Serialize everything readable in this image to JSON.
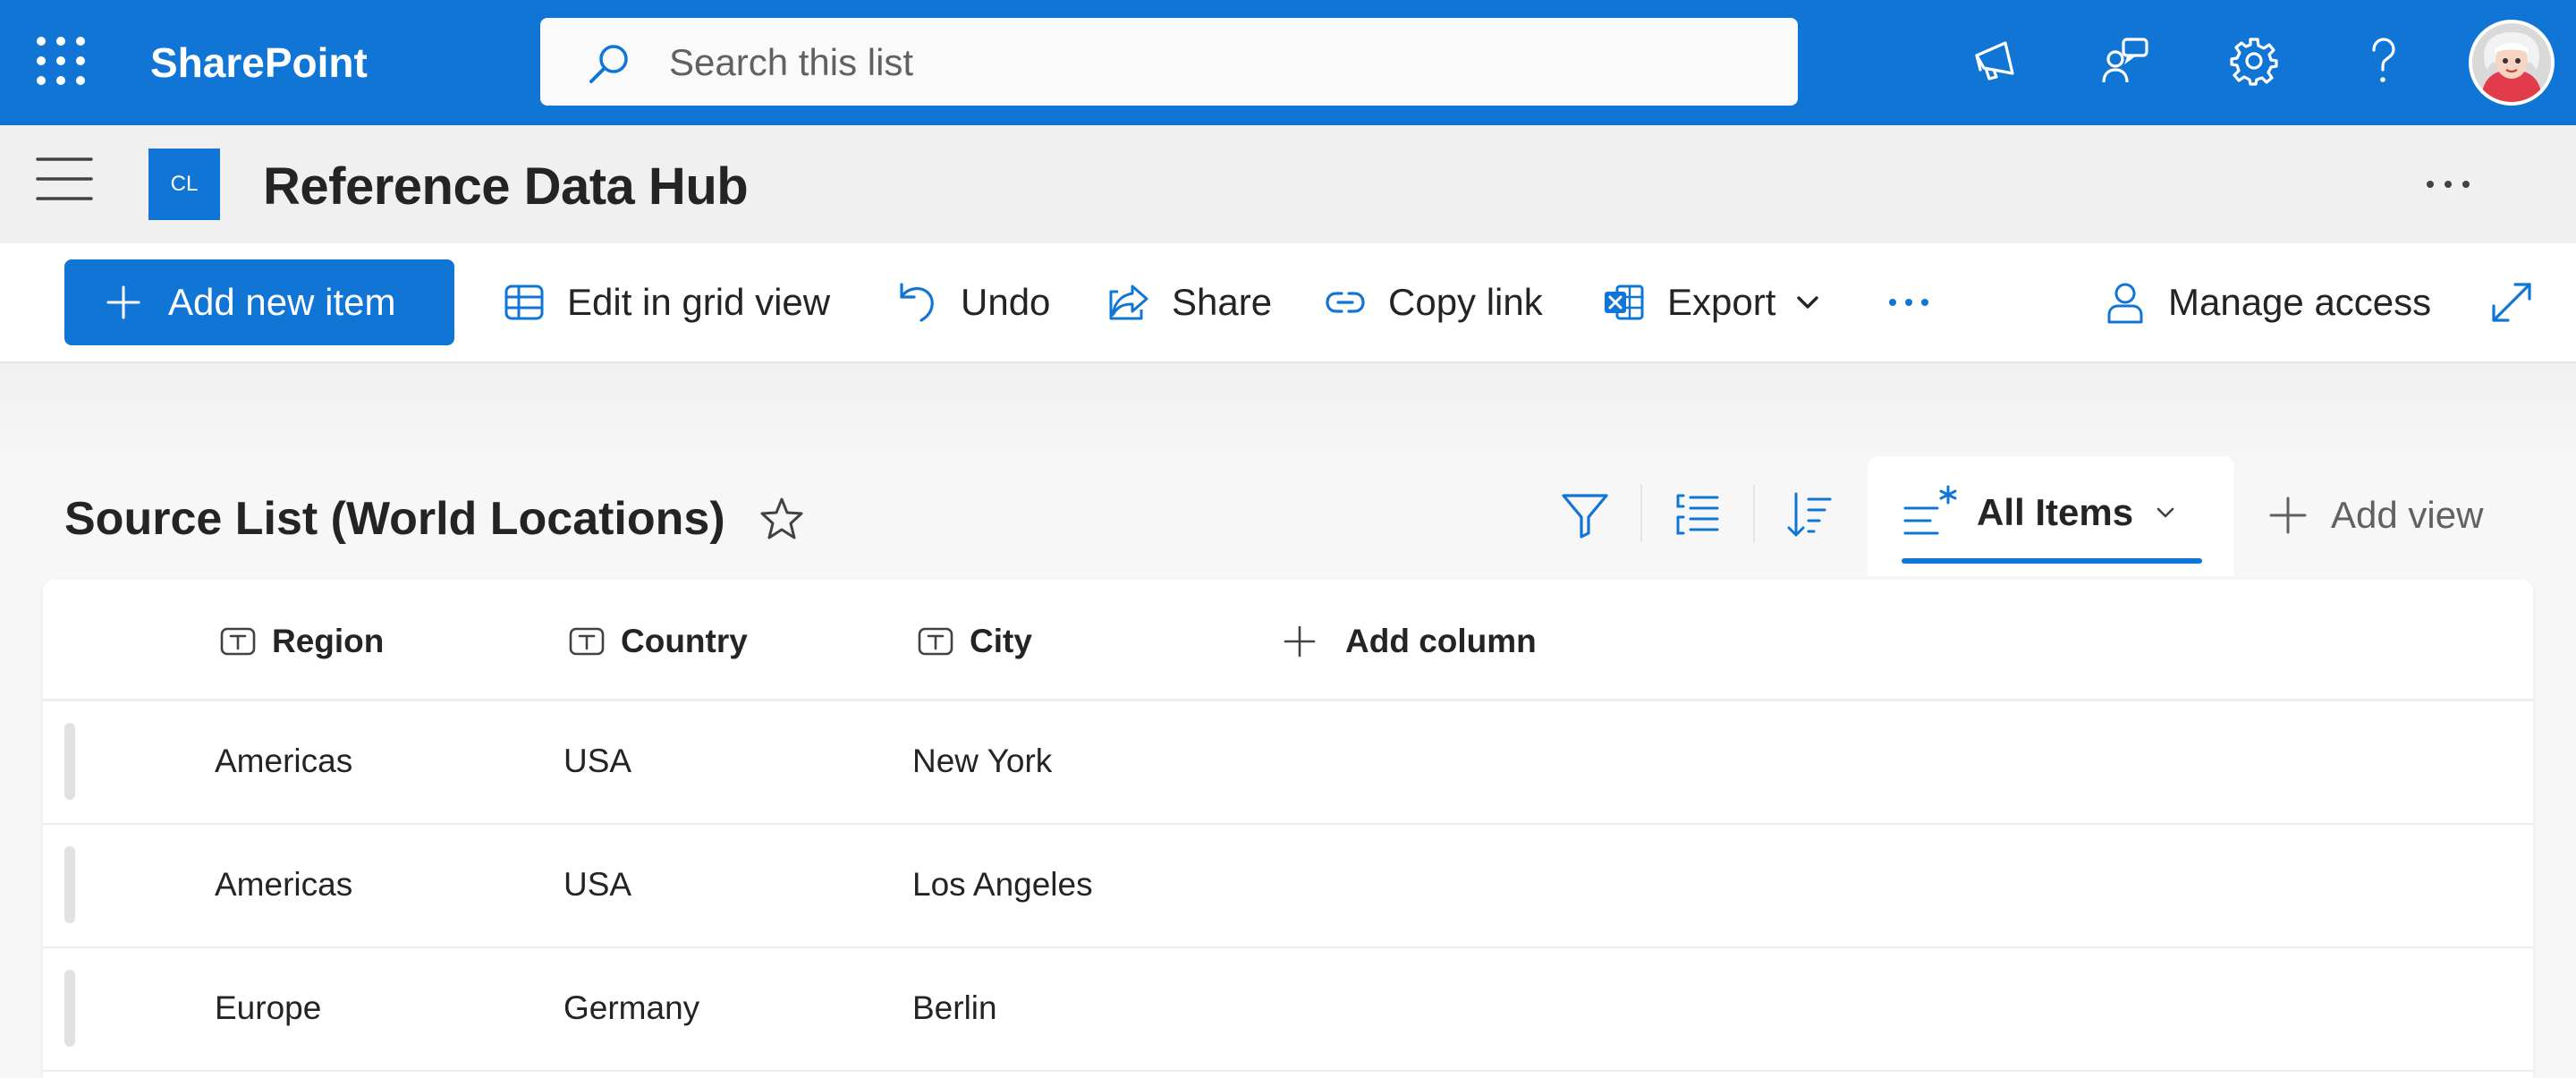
{
  "suitebar": {
    "app_name": "SharePoint",
    "search_placeholder": "Search this list",
    "icons": [
      "waffle-icon",
      "megaphone-icon",
      "feedback-icon",
      "gear-icon",
      "help-icon"
    ],
    "accent_color": "#1175d6"
  },
  "site": {
    "logo_text": "CL",
    "title": "Reference Data Hub"
  },
  "commandbar": {
    "add_new_item": "Add new item",
    "edit_grid": "Edit in grid view",
    "undo": "Undo",
    "share": "Share",
    "copy_link": "Copy link",
    "export": "Export",
    "manage_access": "Manage access"
  },
  "list": {
    "title": "Source List (World Locations)",
    "view_name": "All Items",
    "add_view": "Add view",
    "columns": [
      "Region",
      "Country",
      "City"
    ],
    "add_column": "Add column",
    "rows": [
      {
        "region": "Americas",
        "country": "USA",
        "city": "New York"
      },
      {
        "region": "Americas",
        "country": "USA",
        "city": "Los Angeles"
      },
      {
        "region": "Europe",
        "country": "Germany",
        "city": "Berlin"
      }
    ]
  }
}
